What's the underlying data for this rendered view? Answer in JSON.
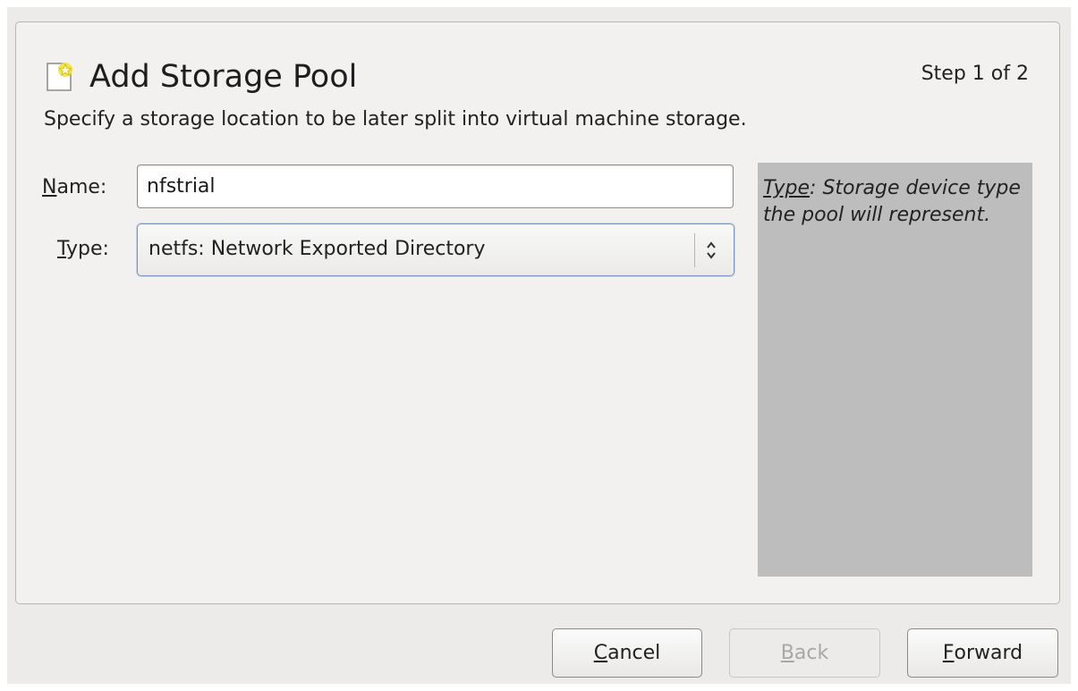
{
  "header": {
    "title": "Add Storage Pool",
    "step": "Step 1 of 2",
    "subtitle": "Specify a storage location to be later split into virtual machine storage.",
    "icon": "new-storage-pool-icon"
  },
  "form": {
    "name_label_mnemonic": "N",
    "name_label_rest": "ame:",
    "name_value": "nfstrial",
    "type_label_mnemonic": "T",
    "type_label_rest": "ype:",
    "type_value": "netfs: Network Exported Directory"
  },
  "help": {
    "keyword": "Type",
    "text": ": Storage device type the pool will represent."
  },
  "buttons": {
    "cancel_mnemonic": "C",
    "cancel_rest": "ancel",
    "back_mnemonic": "B",
    "back_rest": "ack",
    "forward_mnemonic": "F",
    "forward_rest": "orward"
  },
  "colors": {
    "panel_bg": "#f2f1f0",
    "help_bg": "#bdbdbd",
    "select_focus": "#7c97bc"
  }
}
